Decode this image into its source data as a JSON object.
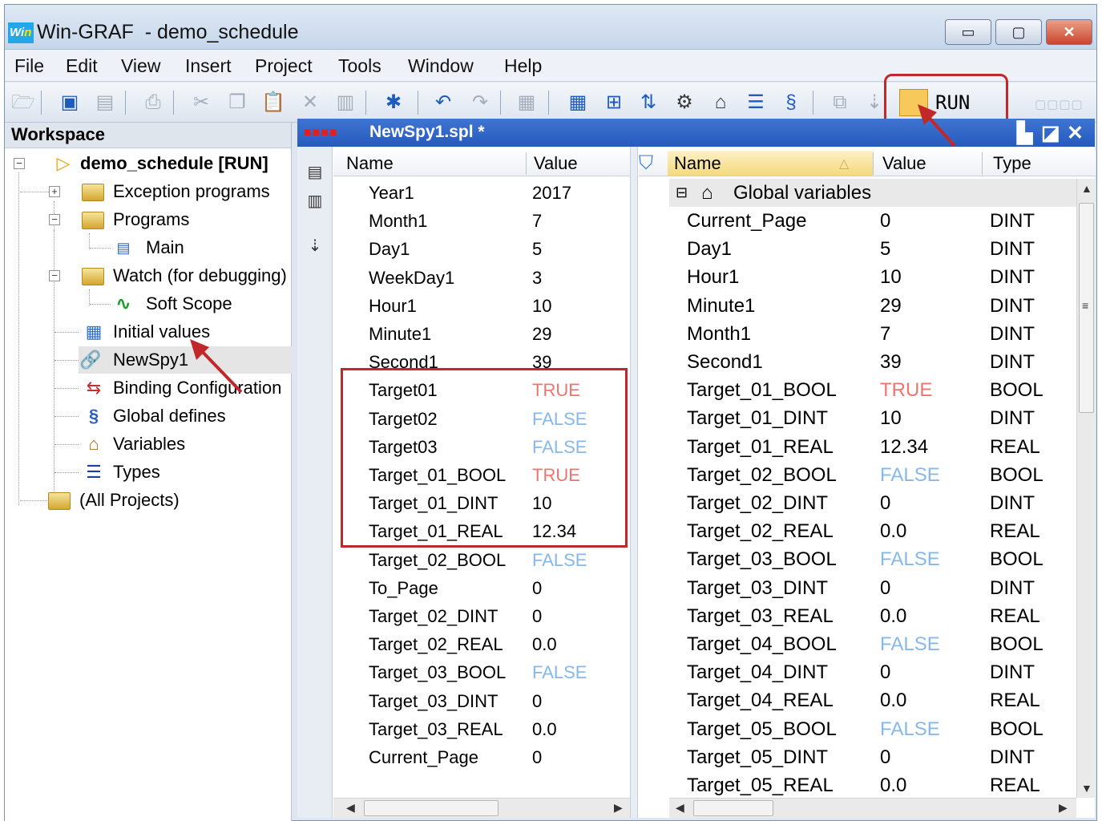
{
  "window": {
    "title": "Win-GRAF  - demo_schedule",
    "logo_text": "Wi",
    "logo_text_accent": "n",
    "controls": {
      "minimize": "▭",
      "maximize": "▢",
      "close": "✕"
    }
  },
  "menu": [
    "File",
    "Edit",
    "View",
    "Insert",
    "Project",
    "Tools",
    "Window",
    "Help"
  ],
  "toolbar": {
    "run_status": "RUN",
    "icons": [
      "open-icon",
      "save-icon",
      "save-as-icon",
      "print-icon",
      "cut-icon",
      "copy-icon",
      "paste-icon",
      "delete-icon",
      "clear-icon",
      "new-item-icon",
      "open-item-icon",
      "undo-icon",
      "redo-icon",
      "build-icon",
      "grid-icon",
      "network-icon",
      "io-icon",
      "debug-icon",
      "home-icon",
      "types-icon",
      "defines-icon",
      "window-icon",
      "download-icon",
      "run-icon"
    ]
  },
  "workspace": {
    "header": "Workspace",
    "tree": [
      {
        "label": "demo_schedule [RUN]",
        "icon": "project-arrow-icon"
      },
      {
        "label": "Exception programs",
        "icon": "folder-icon"
      },
      {
        "label": "Programs",
        "icon": "folder-icon"
      },
      {
        "label": "Main",
        "icon": "program-icon"
      },
      {
        "label": "Watch (for debugging)",
        "icon": "folder-icon"
      },
      {
        "label": "Soft Scope",
        "icon": "scope-icon"
      },
      {
        "label": "Initial values",
        "icon": "table-icon"
      },
      {
        "label": "NewSpy1",
        "icon": "spy-icon"
      },
      {
        "label": "Binding Configuration",
        "icon": "binding-icon"
      },
      {
        "label": "Global defines",
        "icon": "defines-icon"
      },
      {
        "label": "Variables",
        "icon": "variables-icon"
      },
      {
        "label": "Types",
        "icon": "types-icon"
      },
      {
        "label": "(All Projects)",
        "icon": "folder-icon"
      }
    ]
  },
  "spy": {
    "title": "NewSpy1.spl *",
    "columns": {
      "name": "Name",
      "value": "Value"
    },
    "rows": [
      {
        "name": "Year1",
        "value": "2017",
        "kind": "num"
      },
      {
        "name": "Month1",
        "value": "7",
        "kind": "num"
      },
      {
        "name": "Day1",
        "value": "5",
        "kind": "num"
      },
      {
        "name": "WeekDay1",
        "value": "3",
        "kind": "num"
      },
      {
        "name": "Hour1",
        "value": "10",
        "kind": "num"
      },
      {
        "name": "Minute1",
        "value": "29",
        "kind": "num"
      },
      {
        "name": "Second1",
        "value": "39",
        "kind": "num"
      },
      {
        "name": "Target01",
        "value": "TRUE",
        "kind": "true"
      },
      {
        "name": "Target02",
        "value": "FALSE",
        "kind": "false"
      },
      {
        "name": "Target03",
        "value": "FALSE",
        "kind": "false"
      },
      {
        "name": "Target_01_BOOL",
        "value": "TRUE",
        "kind": "true"
      },
      {
        "name": "Target_01_DINT",
        "value": "10",
        "kind": "num"
      },
      {
        "name": "Target_01_REAL",
        "value": "12.34",
        "kind": "num"
      },
      {
        "name": "Target_02_BOOL",
        "value": "FALSE",
        "kind": "false"
      },
      {
        "name": "To_Page",
        "value": "0",
        "kind": "num"
      },
      {
        "name": "Target_02_DINT",
        "value": "0",
        "kind": "num"
      },
      {
        "name": "Target_02_REAL",
        "value": "0.0",
        "kind": "num"
      },
      {
        "name": "Target_03_BOOL",
        "value": "FALSE",
        "kind": "false"
      },
      {
        "name": "Target_03_DINT",
        "value": "0",
        "kind": "num"
      },
      {
        "name": "Target_03_REAL",
        "value": "0.0",
        "kind": "num"
      },
      {
        "name": "Current_Page",
        "value": "0",
        "kind": "num"
      }
    ]
  },
  "variables": {
    "columns": {
      "name": "Name",
      "value": "Value",
      "type": "Type"
    },
    "group_label": "Global variables",
    "rows": [
      {
        "name": "Current_Page",
        "value": "0",
        "type": "DINT",
        "kind": "num"
      },
      {
        "name": "Day1",
        "value": "5",
        "type": "DINT",
        "kind": "num"
      },
      {
        "name": "Hour1",
        "value": "10",
        "type": "DINT",
        "kind": "num"
      },
      {
        "name": "Minute1",
        "value": "29",
        "type": "DINT",
        "kind": "num"
      },
      {
        "name": "Month1",
        "value": "7",
        "type": "DINT",
        "kind": "num"
      },
      {
        "name": "Second1",
        "value": "39",
        "type": "DINT",
        "kind": "num"
      },
      {
        "name": "Target_01_BOOL",
        "value": "TRUE",
        "type": "BOOL",
        "kind": "true"
      },
      {
        "name": "Target_01_DINT",
        "value": "10",
        "type": "DINT",
        "kind": "num"
      },
      {
        "name": "Target_01_REAL",
        "value": "12.34",
        "type": "REAL",
        "kind": "num"
      },
      {
        "name": "Target_02_BOOL",
        "value": "FALSE",
        "type": "BOOL",
        "kind": "false"
      },
      {
        "name": "Target_02_DINT",
        "value": "0",
        "type": "DINT",
        "kind": "num"
      },
      {
        "name": "Target_02_REAL",
        "value": "0.0",
        "type": "REAL",
        "kind": "num"
      },
      {
        "name": "Target_03_BOOL",
        "value": "FALSE",
        "type": "BOOL",
        "kind": "false"
      },
      {
        "name": "Target_03_DINT",
        "value": "0",
        "type": "DINT",
        "kind": "num"
      },
      {
        "name": "Target_03_REAL",
        "value": "0.0",
        "type": "REAL",
        "kind": "num"
      },
      {
        "name": "Target_04_BOOL",
        "value": "FALSE",
        "type": "BOOL",
        "kind": "false"
      },
      {
        "name": "Target_04_DINT",
        "value": "0",
        "type": "DINT",
        "kind": "num"
      },
      {
        "name": "Target_04_REAL",
        "value": "0.0",
        "type": "REAL",
        "kind": "num"
      },
      {
        "name": "Target_05_BOOL",
        "value": "FALSE",
        "type": "BOOL",
        "kind": "false"
      },
      {
        "name": "Target_05_DINT",
        "value": "0",
        "type": "DINT",
        "kind": "num"
      },
      {
        "name": "Target_05_REAL",
        "value": "0.0",
        "type": "REAL",
        "kind": "num"
      }
    ]
  },
  "colors": {
    "true_value": "#f0736c",
    "false_value": "#86b8ee",
    "annotation": "#c0282a",
    "spy_title_bar": "#2f65c8"
  }
}
